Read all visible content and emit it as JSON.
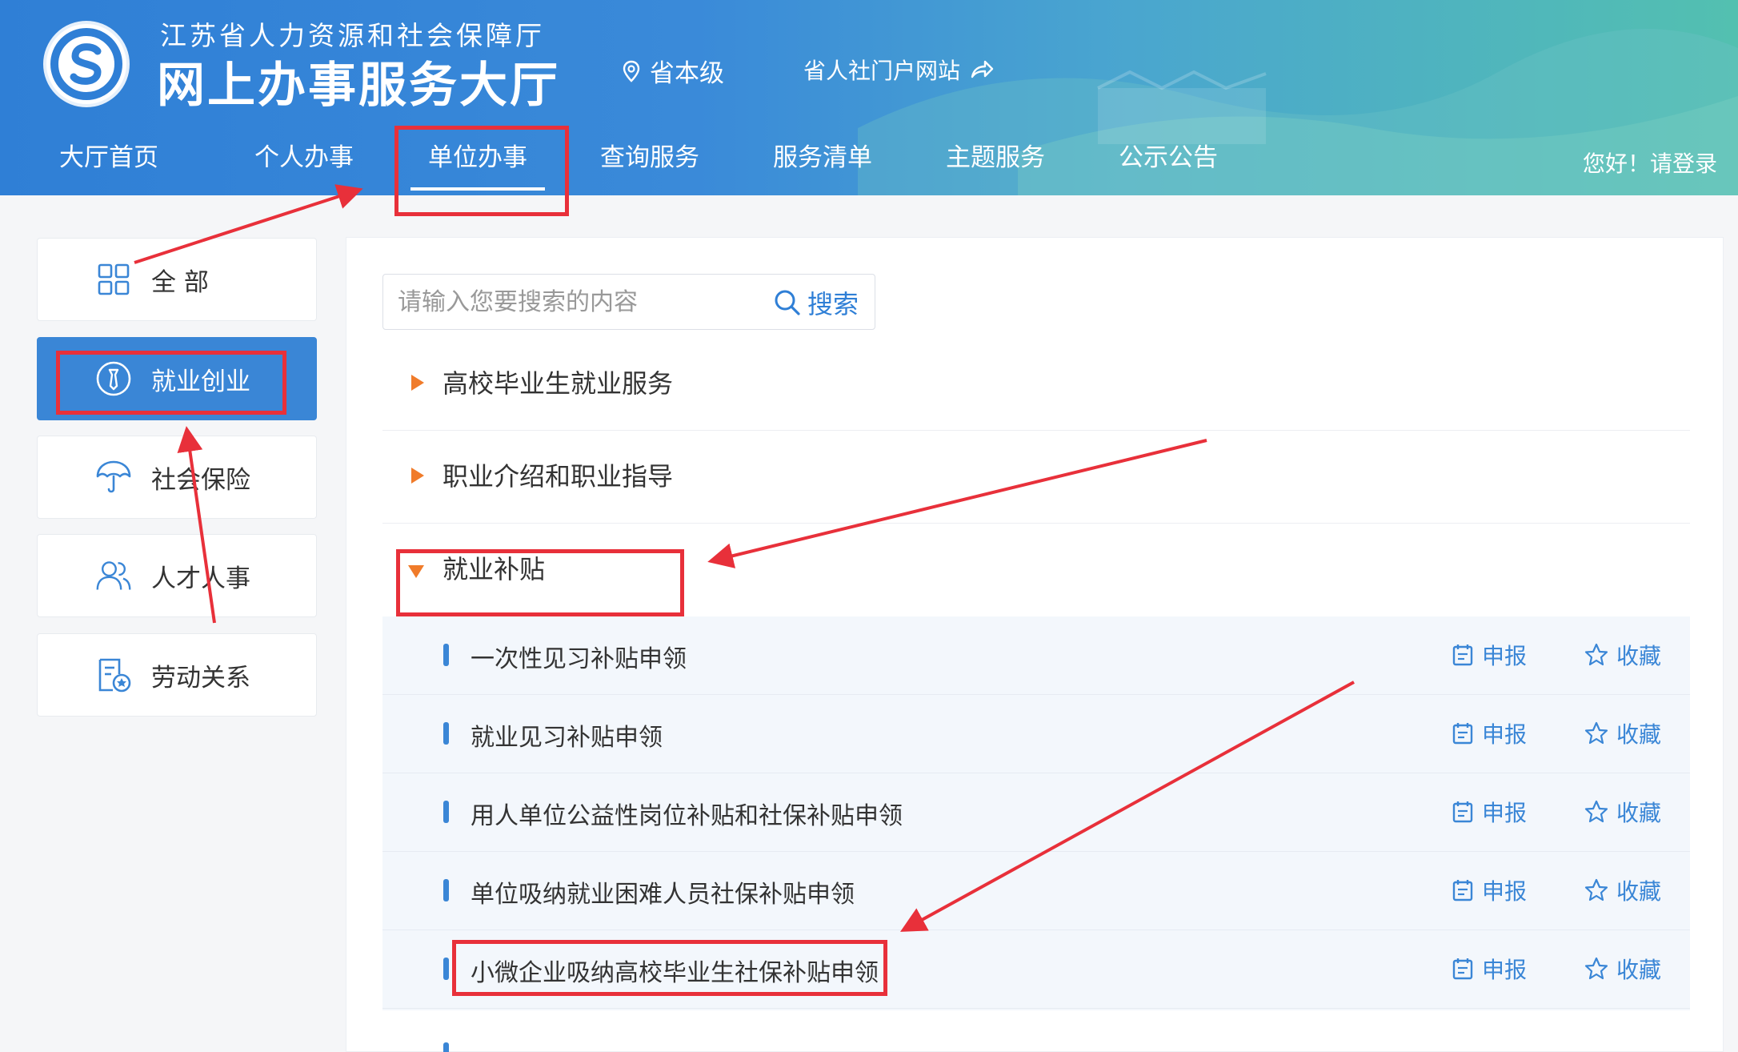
{
  "header": {
    "org_name": "江苏省人力资源和社会保障厅",
    "site_name": "网上办事服务大厅",
    "logo_ring_text": "江苏省人力资源和社会保障厅",
    "location": "省本级",
    "portal_link": "省人社门户网站",
    "login": "您好！请登录"
  },
  "nav": {
    "items": [
      "大厅首页",
      "个人办事",
      "单位办事",
      "查询服务",
      "服务清单",
      "主题服务",
      "公示公告"
    ],
    "active_index": 2
  },
  "sidebar": {
    "items": [
      "全 部",
      "就业创业",
      "社会保险",
      "人才人事",
      "劳动关系"
    ],
    "active_index": 1
  },
  "search": {
    "placeholder": "请输入您要搜索的内容",
    "button": "搜索"
  },
  "categories": [
    {
      "label": "高校毕业生就业服务",
      "expanded": false
    },
    {
      "label": "职业介绍和职业指导",
      "expanded": false
    },
    {
      "label": "就业补贴",
      "expanded": true
    }
  ],
  "subitems": [
    "一次性见习补贴申领",
    "就业见习补贴申领",
    "用人单位公益性岗位补贴和社保补贴申领",
    "单位吸纳就业困难人员社保补贴申领",
    "小微企业吸纳高校毕业生社保补贴申领"
  ],
  "actions": {
    "apply": "申报",
    "favorite": "收藏"
  },
  "colors": {
    "primary": "#3a86d6",
    "header_start": "#2f7fd6",
    "header_end": "#53c0b0",
    "triangle": "#f07b2a",
    "annotation": "#e8303a"
  }
}
